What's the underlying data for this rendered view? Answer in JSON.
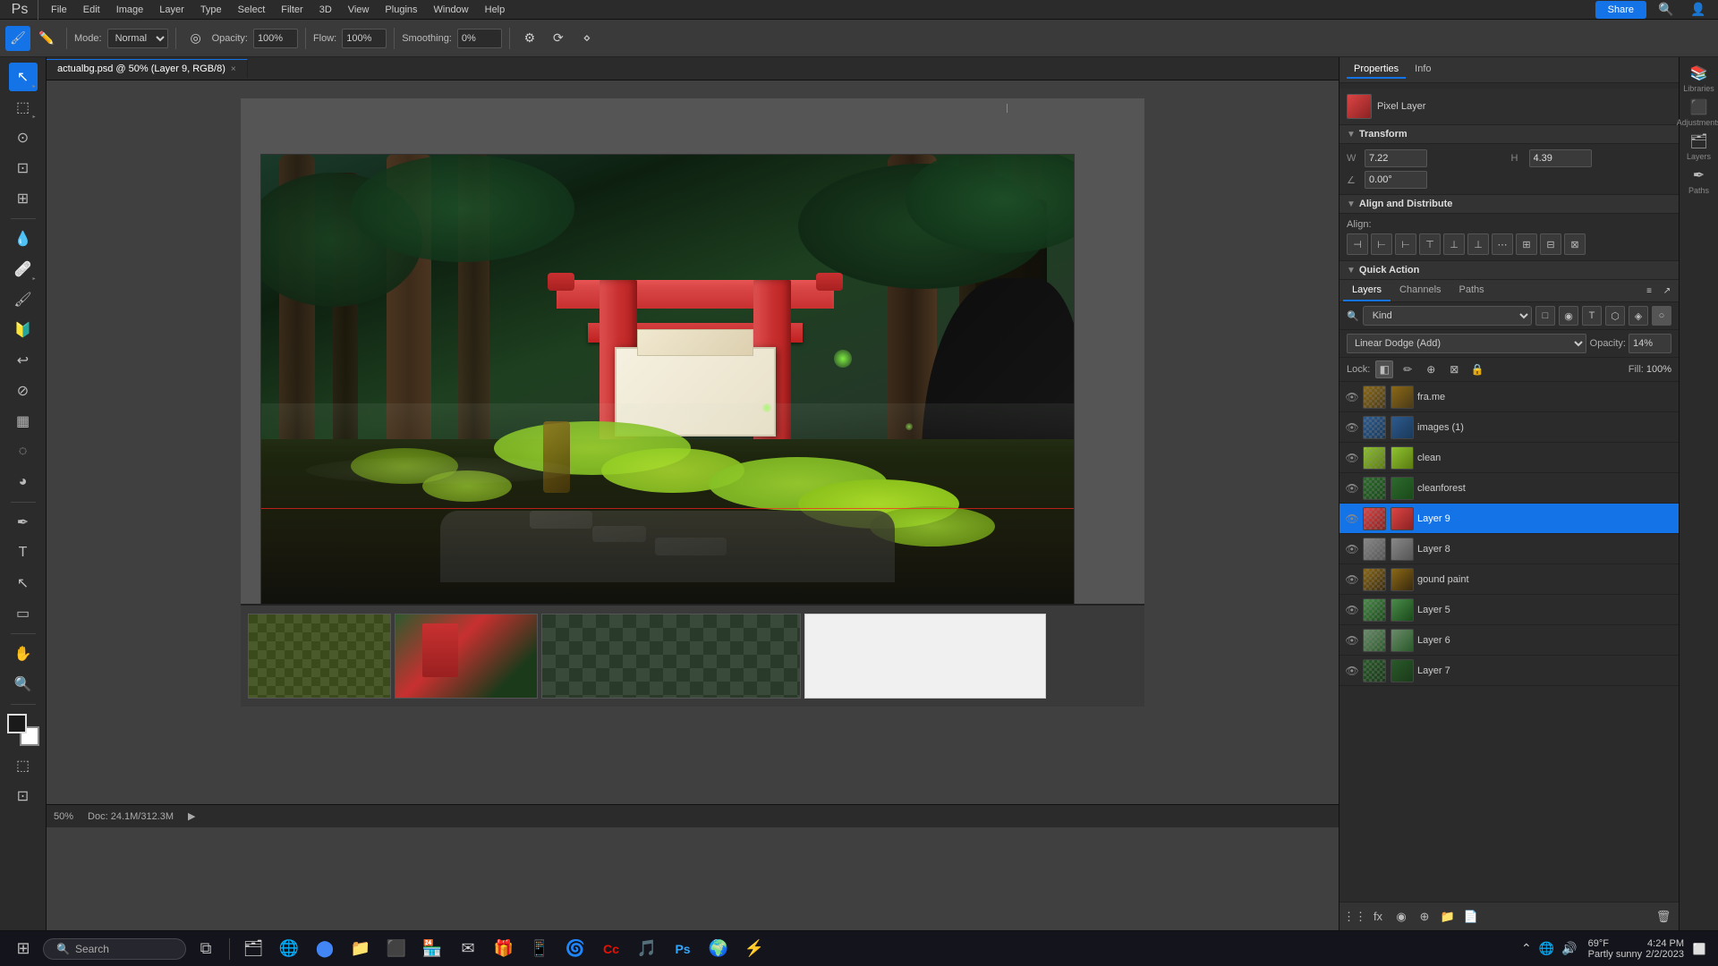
{
  "app": {
    "title": "Adobe Photoshop",
    "file_tab": "actualbg.psd @ 50% (Layer 9, RGB/8)",
    "zoom": "50%"
  },
  "menu": {
    "items": [
      "File",
      "Edit",
      "Image",
      "Layer",
      "Type",
      "Select",
      "Filter",
      "3D",
      "View",
      "Plugins",
      "Window",
      "Help"
    ]
  },
  "toolbar": {
    "mode_label": "Mode:",
    "mode_value": "Normal",
    "opacity_label": "Opacity:",
    "opacity_value": "100%",
    "flow_label": "Flow:",
    "flow_value": "100%",
    "smoothing_label": "Smoothing:",
    "smoothing_value": "0%"
  },
  "tab": {
    "filename": "actualbg.psd @ 50% (Layer 9, RGB/8)",
    "close": "×"
  },
  "properties": {
    "tabs": [
      "Properties",
      "Info"
    ],
    "layer_label": "Pixel Layer",
    "transform": {
      "title": "Transform",
      "w_label": "W",
      "w_value": "7.22",
      "h_label": "H",
      "h_value": "4.39",
      "angle_label": "∠",
      "angle_value": "0.00°"
    },
    "align": {
      "title": "Align and Distribute",
      "label": "Align:"
    },
    "quick_actions": {
      "title": "Quick Action"
    }
  },
  "layers_panel": {
    "tabs": [
      "Layers",
      "Channels",
      "Paths"
    ],
    "search_placeholder": "Kind",
    "blend_mode": "Linear Dodge (Add)",
    "opacity_label": "Opacity:",
    "opacity_value": "14%",
    "lock_label": "Lock:",
    "layers": [
      {
        "name": "fra.me",
        "visible": true,
        "type": "normal"
      },
      {
        "name": "images (1)",
        "visible": true,
        "type": "normal"
      },
      {
        "name": "clean",
        "visible": true,
        "type": "normal"
      },
      {
        "name": "cleanforest",
        "visible": true,
        "type": "normal"
      },
      {
        "name": "Layer 9",
        "visible": true,
        "type": "normal",
        "active": true
      },
      {
        "name": "Layer 8",
        "visible": true,
        "type": "normal"
      },
      {
        "name": "gound paint",
        "visible": true,
        "type": "normal"
      },
      {
        "name": "Layer 5",
        "visible": true,
        "type": "normal"
      },
      {
        "name": "Layer 6",
        "visible": true,
        "type": "normal"
      },
      {
        "name": "Layer 7",
        "visible": true,
        "type": "normal"
      }
    ],
    "bottom_icons": [
      "fx",
      "circle",
      "square",
      "folder-plus",
      "paper",
      "trash"
    ]
  },
  "far_right": {
    "panels": [
      {
        "icon": "📚",
        "label": "Libraries"
      },
      {
        "icon": "⚙",
        "label": "Adjustments"
      },
      {
        "icon": "🗂",
        "label": "Layers"
      }
    ]
  },
  "status_bar": {
    "zoom": "50%",
    "doc_info": "Doc: 24.1M/312.3M"
  },
  "taskbar": {
    "search_placeholder": "Search",
    "time": "4:24 PM",
    "date": "2/2/2023",
    "weather_temp": "69°F",
    "weather_desc": "Partly sunny"
  }
}
